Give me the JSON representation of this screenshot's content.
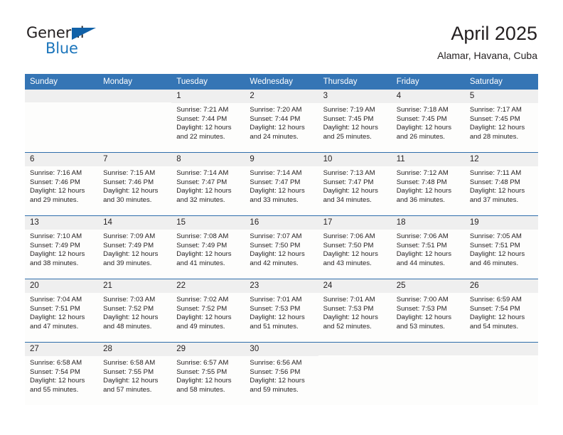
{
  "brand": {
    "name_top": "General",
    "name_bottom": "Blue",
    "triangle_color": "#1061a8",
    "blue_color": "#1b75bb"
  },
  "header": {
    "title": "April 2025",
    "subtitle": "Alamar, Havana, Cuba"
  },
  "theme": {
    "header_blue": "#3575b5",
    "row_rule_blue": "#2f6eab",
    "daynum_band": "#efefef",
    "cell_background": "#fdfdfc",
    "text": "#231f20"
  },
  "weekday_headers": [
    "Sunday",
    "Monday",
    "Tuesday",
    "Wednesday",
    "Thursday",
    "Friday",
    "Saturday"
  ],
  "labels": {
    "sunrise_prefix": "Sunrise:",
    "sunset_prefix": "Sunset:",
    "daylight_prefix": "Daylight:"
  },
  "weeks": [
    [
      {
        "day": "",
        "empty": true
      },
      {
        "day": "",
        "empty": true
      },
      {
        "day": "1",
        "sunrise": "Sunrise: 7:21 AM",
        "sunset": "Sunset: 7:44 PM",
        "daylight_line1": "Daylight: 12 hours",
        "daylight_line2": "and 22 minutes."
      },
      {
        "day": "2",
        "sunrise": "Sunrise: 7:20 AM",
        "sunset": "Sunset: 7:44 PM",
        "daylight_line1": "Daylight: 12 hours",
        "daylight_line2": "and 24 minutes."
      },
      {
        "day": "3",
        "sunrise": "Sunrise: 7:19 AM",
        "sunset": "Sunset: 7:45 PM",
        "daylight_line1": "Daylight: 12 hours",
        "daylight_line2": "and 25 minutes."
      },
      {
        "day": "4",
        "sunrise": "Sunrise: 7:18 AM",
        "sunset": "Sunset: 7:45 PM",
        "daylight_line1": "Daylight: 12 hours",
        "daylight_line2": "and 26 minutes."
      },
      {
        "day": "5",
        "sunrise": "Sunrise: 7:17 AM",
        "sunset": "Sunset: 7:45 PM",
        "daylight_line1": "Daylight: 12 hours",
        "daylight_line2": "and 28 minutes."
      }
    ],
    [
      {
        "day": "6",
        "sunrise": "Sunrise: 7:16 AM",
        "sunset": "Sunset: 7:46 PM",
        "daylight_line1": "Daylight: 12 hours",
        "daylight_line2": "and 29 minutes."
      },
      {
        "day": "7",
        "sunrise": "Sunrise: 7:15 AM",
        "sunset": "Sunset: 7:46 PM",
        "daylight_line1": "Daylight: 12 hours",
        "daylight_line2": "and 30 minutes."
      },
      {
        "day": "8",
        "sunrise": "Sunrise: 7:14 AM",
        "sunset": "Sunset: 7:47 PM",
        "daylight_line1": "Daylight: 12 hours",
        "daylight_line2": "and 32 minutes."
      },
      {
        "day": "9",
        "sunrise": "Sunrise: 7:14 AM",
        "sunset": "Sunset: 7:47 PM",
        "daylight_line1": "Daylight: 12 hours",
        "daylight_line2": "and 33 minutes."
      },
      {
        "day": "10",
        "sunrise": "Sunrise: 7:13 AM",
        "sunset": "Sunset: 7:47 PM",
        "daylight_line1": "Daylight: 12 hours",
        "daylight_line2": "and 34 minutes."
      },
      {
        "day": "11",
        "sunrise": "Sunrise: 7:12 AM",
        "sunset": "Sunset: 7:48 PM",
        "daylight_line1": "Daylight: 12 hours",
        "daylight_line2": "and 36 minutes."
      },
      {
        "day": "12",
        "sunrise": "Sunrise: 7:11 AM",
        "sunset": "Sunset: 7:48 PM",
        "daylight_line1": "Daylight: 12 hours",
        "daylight_line2": "and 37 minutes."
      }
    ],
    [
      {
        "day": "13",
        "sunrise": "Sunrise: 7:10 AM",
        "sunset": "Sunset: 7:49 PM",
        "daylight_line1": "Daylight: 12 hours",
        "daylight_line2": "and 38 minutes."
      },
      {
        "day": "14",
        "sunrise": "Sunrise: 7:09 AM",
        "sunset": "Sunset: 7:49 PM",
        "daylight_line1": "Daylight: 12 hours",
        "daylight_line2": "and 39 minutes."
      },
      {
        "day": "15",
        "sunrise": "Sunrise: 7:08 AM",
        "sunset": "Sunset: 7:49 PM",
        "daylight_line1": "Daylight: 12 hours",
        "daylight_line2": "and 41 minutes."
      },
      {
        "day": "16",
        "sunrise": "Sunrise: 7:07 AM",
        "sunset": "Sunset: 7:50 PM",
        "daylight_line1": "Daylight: 12 hours",
        "daylight_line2": "and 42 minutes."
      },
      {
        "day": "17",
        "sunrise": "Sunrise: 7:06 AM",
        "sunset": "Sunset: 7:50 PM",
        "daylight_line1": "Daylight: 12 hours",
        "daylight_line2": "and 43 minutes."
      },
      {
        "day": "18",
        "sunrise": "Sunrise: 7:06 AM",
        "sunset": "Sunset: 7:51 PM",
        "daylight_line1": "Daylight: 12 hours",
        "daylight_line2": "and 44 minutes."
      },
      {
        "day": "19",
        "sunrise": "Sunrise: 7:05 AM",
        "sunset": "Sunset: 7:51 PM",
        "daylight_line1": "Daylight: 12 hours",
        "daylight_line2": "and 46 minutes."
      }
    ],
    [
      {
        "day": "20",
        "sunrise": "Sunrise: 7:04 AM",
        "sunset": "Sunset: 7:51 PM",
        "daylight_line1": "Daylight: 12 hours",
        "daylight_line2": "and 47 minutes."
      },
      {
        "day": "21",
        "sunrise": "Sunrise: 7:03 AM",
        "sunset": "Sunset: 7:52 PM",
        "daylight_line1": "Daylight: 12 hours",
        "daylight_line2": "and 48 minutes."
      },
      {
        "day": "22",
        "sunrise": "Sunrise: 7:02 AM",
        "sunset": "Sunset: 7:52 PM",
        "daylight_line1": "Daylight: 12 hours",
        "daylight_line2": "and 49 minutes."
      },
      {
        "day": "23",
        "sunrise": "Sunrise: 7:01 AM",
        "sunset": "Sunset: 7:53 PM",
        "daylight_line1": "Daylight: 12 hours",
        "daylight_line2": "and 51 minutes."
      },
      {
        "day": "24",
        "sunrise": "Sunrise: 7:01 AM",
        "sunset": "Sunset: 7:53 PM",
        "daylight_line1": "Daylight: 12 hours",
        "daylight_line2": "and 52 minutes."
      },
      {
        "day": "25",
        "sunrise": "Sunrise: 7:00 AM",
        "sunset": "Sunset: 7:53 PM",
        "daylight_line1": "Daylight: 12 hours",
        "daylight_line2": "and 53 minutes."
      },
      {
        "day": "26",
        "sunrise": "Sunrise: 6:59 AM",
        "sunset": "Sunset: 7:54 PM",
        "daylight_line1": "Daylight: 12 hours",
        "daylight_line2": "and 54 minutes."
      }
    ],
    [
      {
        "day": "27",
        "sunrise": "Sunrise: 6:58 AM",
        "sunset": "Sunset: 7:54 PM",
        "daylight_line1": "Daylight: 12 hours",
        "daylight_line2": "and 55 minutes."
      },
      {
        "day": "28",
        "sunrise": "Sunrise: 6:58 AM",
        "sunset": "Sunset: 7:55 PM",
        "daylight_line1": "Daylight: 12 hours",
        "daylight_line2": "and 57 minutes."
      },
      {
        "day": "29",
        "sunrise": "Sunrise: 6:57 AM",
        "sunset": "Sunset: 7:55 PM",
        "daylight_line1": "Daylight: 12 hours",
        "daylight_line2": "and 58 minutes."
      },
      {
        "day": "30",
        "sunrise": "Sunrise: 6:56 AM",
        "sunset": "Sunset: 7:56 PM",
        "daylight_line1": "Daylight: 12 hours",
        "daylight_line2": "and 59 minutes."
      },
      {
        "day": "",
        "empty": true
      },
      {
        "day": "",
        "empty": true
      },
      {
        "day": "",
        "empty": true
      }
    ]
  ]
}
